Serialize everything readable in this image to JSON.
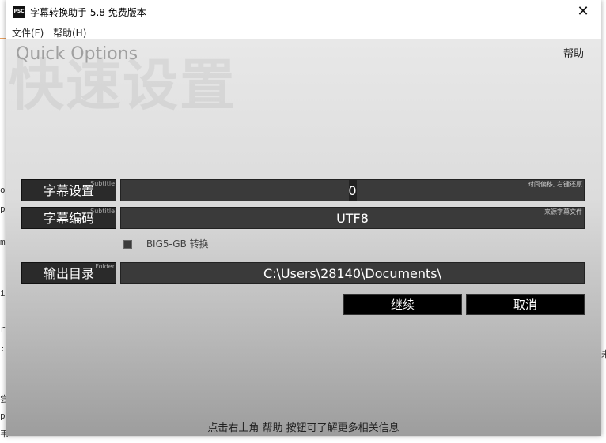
{
  "window": {
    "app_icon": "PSC",
    "title": "字幕转换助手 5.8 免费版本",
    "close_glyph": "✕"
  },
  "menu": {
    "items": [
      {
        "label": "文件(F)"
      },
      {
        "label": "帮助(H)"
      }
    ]
  },
  "panel": {
    "watermark": "快速设置",
    "heading": "Quick Options",
    "help_label": "帮助"
  },
  "subtitle_settings": {
    "label": "字幕设置",
    "tag": "Subtitle",
    "hint": "时间偏移, 右键还原",
    "value": "0"
  },
  "subtitle_encoding": {
    "label": "字幕编码",
    "tag": "Subtitle",
    "hint": "来源字幕文件",
    "value": "UTF8"
  },
  "big5_convert": {
    "label": "BIG5-GB 转换"
  },
  "output_dir": {
    "label": "输出目录",
    "tag": "Folder",
    "value": "C:\\Users\\28140\\Documents\\"
  },
  "buttons": {
    "continue": "继续",
    "cancel": "取消"
  },
  "footer": "点击右上角 帮助 按钮可了解更多相关信息",
  "icons": {
    "close": "close-icon",
    "checkbox": "checkbox-icon"
  }
}
